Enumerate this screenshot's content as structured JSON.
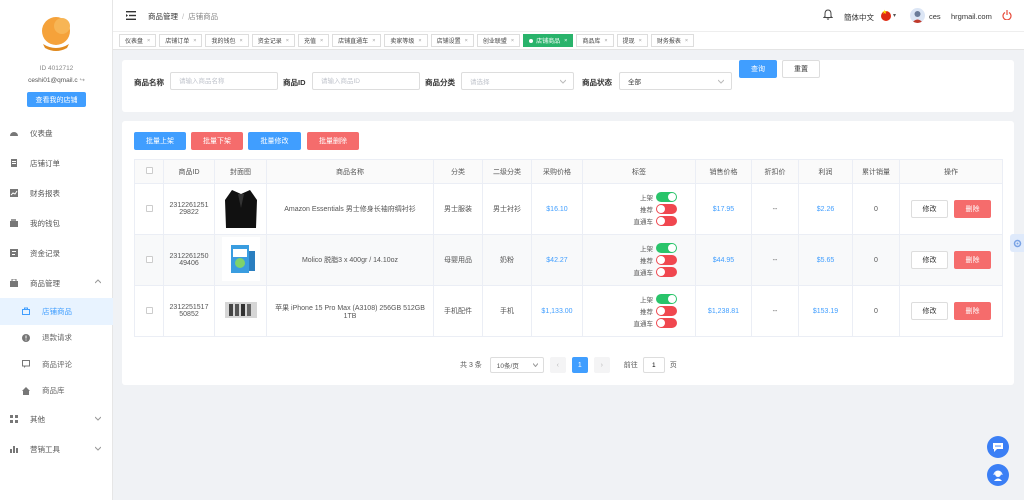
{
  "sidebar": {
    "user_id": "ID 4012712",
    "email": "ceshi01@qmail.c",
    "shop_button": "查看我的店铺",
    "items": [
      {
        "label": "仪表盘",
        "icon": "dashboard-icon"
      },
      {
        "label": "店铺订单",
        "icon": "order-icon"
      },
      {
        "label": "财务报表",
        "icon": "report-icon"
      },
      {
        "label": "我的钱包",
        "icon": "wallet-icon"
      },
      {
        "label": "资金记录",
        "icon": "record-icon"
      },
      {
        "label": "商品管理",
        "icon": "goods-icon"
      },
      {
        "label": "店铺商品",
        "icon": "bag-icon"
      },
      {
        "label": "退款请求",
        "icon": "refund-icon"
      },
      {
        "label": "商品评论",
        "icon": "comment-icon"
      },
      {
        "label": "商品库",
        "icon": "home-icon"
      },
      {
        "label": "其他",
        "icon": "grid-icon"
      },
      {
        "label": "营销工具",
        "icon": "chart-icon"
      }
    ]
  },
  "header": {
    "breadcrumb_parent": "商品管理",
    "breadcrumb_current": "店铺商品",
    "language": "簡体中文",
    "username": "ces",
    "email": "hrgmail.com"
  },
  "tabs": [
    {
      "label": "仪表盘"
    },
    {
      "label": "店铺订单"
    },
    {
      "label": "我的钱包"
    },
    {
      "label": "资金记录"
    },
    {
      "label": "充值"
    },
    {
      "label": "店铺直通车"
    },
    {
      "label": "卖家等级"
    },
    {
      "label": "店铺设置"
    },
    {
      "label": "创业联盟"
    },
    {
      "label": "店铺商品",
      "active": true
    },
    {
      "label": "商品库"
    },
    {
      "label": "提现"
    },
    {
      "label": "财务报表"
    }
  ],
  "search": {
    "name_label": "商品名称",
    "name_placeholder": "请输入商品名称",
    "id_label": "商品ID",
    "id_placeholder": "请输入商品ID",
    "category_label": "商品分类",
    "category_placeholder": "请选择",
    "status_label": "商品状态",
    "status_value": "全部",
    "query_button": "查询",
    "reset_button": "重置"
  },
  "actions": {
    "batch_on": "批量上架",
    "batch_off": "批量下架",
    "batch_edit": "批量修改",
    "batch_delete": "批量删除"
  },
  "table": {
    "headers": [
      "商品ID",
      "封面图",
      "商品名称",
      "分类",
      "二级分类",
      "采购价格",
      "标签",
      "销售价格",
      "折扣价",
      "利润",
      "累计销量",
      "操作"
    ],
    "tag_labels": {
      "on_shelf": "上架",
      "recommend": "推荐",
      "express": "直通车"
    },
    "edit_label": "修改",
    "delete_label": "删除",
    "rows": [
      {
        "id": "231226125129822",
        "image": "black-blazer",
        "name": "Amazon Essentials 男士修身长袖府绸衬衫",
        "category": "男士服装",
        "subcategory": "男士衬衫",
        "purchase_price": "$16.10",
        "sale_price": "$17.95",
        "discount": "--",
        "profit": "$2.26",
        "sales": "0",
        "tag_on_shelf": true,
        "tag_recommend": false,
        "tag_express": false
      },
      {
        "id": "231226125049406",
        "image": "detergent-box",
        "name": "Molico 脱脂3 x 400gr / 14.10oz",
        "category": "母婴用品",
        "subcategory": "奶粉",
        "purchase_price": "$42.27",
        "sale_price": "$44.95",
        "discount": "--",
        "profit": "$5.65",
        "sales": "0",
        "tag_on_shelf": true,
        "tag_recommend": false,
        "tag_express": false
      },
      {
        "id": "231225151750852",
        "image": "phone-case",
        "name": "苹果 iPhone 15 Pro Max (A3108) 256GB 512GB 1TB",
        "category": "手机配件",
        "subcategory": "手机",
        "purchase_price": "$1,133.00",
        "sale_price": "$1,238.81",
        "discount": "--",
        "profit": "$153.19",
        "sales": "0",
        "tag_on_shelf": true,
        "tag_recommend": false,
        "tag_express": false
      }
    ]
  },
  "pagination": {
    "total": "共 3 条",
    "page_size": "10条/页",
    "current_page": "1",
    "goto_label": "前往",
    "goto_value": "1",
    "page_suffix": "页"
  },
  "colors": {
    "primary": "#409eff",
    "danger": "#f56c6c",
    "success": "#29c46a"
  }
}
